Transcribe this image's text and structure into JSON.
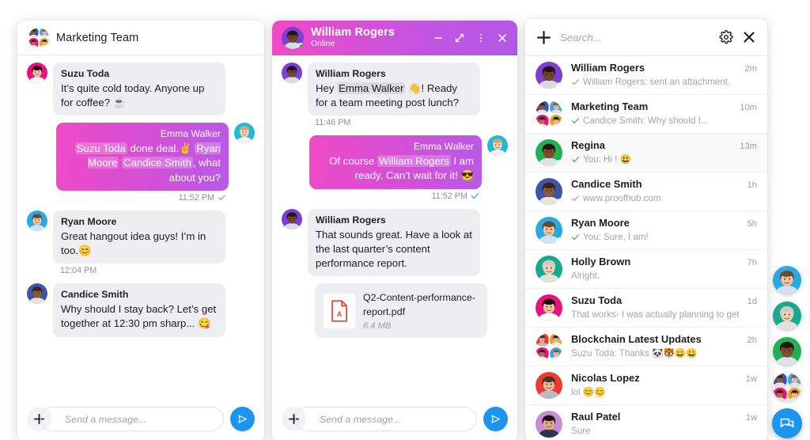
{
  "colors": {
    "accent_blue": "#1b95ef",
    "gradient_from": "#ee4ac6",
    "gradient_to": "#b95ae6",
    "online_green": "#2ed83a",
    "tick_green": "#2fb344",
    "pdf_red": "#e8402a",
    "bubble_in": "#eeedf2"
  },
  "group_panel": {
    "title": "Marketing Team",
    "messages": [
      {
        "direction": "in",
        "sender": "Suzu Toda",
        "parts": [
          {
            "t": "It’s quite cold today. Anyone up for coffee? ☕"
          }
        ],
        "avatar": "suzu"
      },
      {
        "direction": "out",
        "sender": "Emma Walker",
        "parts": [
          {
            "t": "Suzu Toda",
            "mention": true
          },
          {
            "t": " done deal.✌️ "
          },
          {
            "t": "Ryan Moore",
            "mention": true
          },
          {
            "t": " "
          },
          {
            "t": "Candice Smith",
            "mention": true
          },
          {
            "t": ", what about you?"
          }
        ],
        "avatar": "emma",
        "time": "11:52 PM",
        "tick": "gray"
      },
      {
        "direction": "in",
        "sender": "Ryan Moore",
        "parts": [
          {
            "t": "Great hangout idea guys! I’m in too.😊"
          }
        ],
        "avatar": "ryan",
        "time": "12:04 PM"
      },
      {
        "direction": "in",
        "sender": "Candice Smith",
        "parts": [
          {
            "t": "Why should I stay back? Let’s get together at 12:30 pm sharp... 😋"
          }
        ],
        "avatar": "candice"
      }
    ],
    "composer": {
      "placeholder": "Send a message...",
      "value": ""
    }
  },
  "dm_panel": {
    "title": "William Rogers",
    "status": "Online",
    "window_controls": [
      "minimize-icon",
      "expand-icon",
      "more-options-icon",
      "close-icon"
    ],
    "messages": [
      {
        "direction": "in",
        "sender": "William Rogers",
        "parts": [
          {
            "t": "Hey "
          },
          {
            "t": "Emma Walker",
            "mention": true
          },
          {
            "t": " 👋! Ready for a team meeting post lunch?"
          }
        ],
        "avatar": "william",
        "time": "11:46 PM"
      },
      {
        "direction": "out",
        "sender": "Emma Walker",
        "parts": [
          {
            "t": "Of course "
          },
          {
            "t": "William Rogers",
            "mention": true
          },
          {
            "t": " I am ready. Can’t wait for it! 😎"
          }
        ],
        "avatar": "emma",
        "time": "11:52 PM",
        "tick": "blue"
      },
      {
        "direction": "in",
        "sender": "William Rogers",
        "parts": [
          {
            "t": "That sounds great. Have a look at the last quarter’s content performance report."
          }
        ],
        "avatar": "william"
      }
    ],
    "attachment": {
      "filename": "Q2-Content-performance-report.pdf",
      "filesize": "6.4 MB",
      "icon": "pdf-file-icon"
    },
    "composer": {
      "placeholder": "Send a message...",
      "value": ""
    }
  },
  "list_panel": {
    "search": {
      "placeholder": "Search...",
      "value": ""
    },
    "new_chat_label": "+",
    "conversations": [
      {
        "name": "William Rogers",
        "preview": "William Rogers: sent an attachment.",
        "time": "2m",
        "tick": "gray",
        "avatar": "william",
        "online": true,
        "group": false,
        "active": false
      },
      {
        "name": "Marketing Team",
        "preview": "Candice Smith: Why should I...",
        "time": "10m",
        "tick": "green",
        "avatar": "group-marketing",
        "online": false,
        "group": true,
        "active": false
      },
      {
        "name": "Regina",
        "preview": "You: Hi ! 😃",
        "time": "13m",
        "tick": "green",
        "avatar": "regina",
        "online": true,
        "group": false,
        "active": true
      },
      {
        "name": "Candice Smith",
        "preview": "www.proofhub.com",
        "time": "1h",
        "tick": "gray",
        "avatar": "candice",
        "online": true,
        "group": false,
        "active": false
      },
      {
        "name": "Ryan Moore",
        "preview": "You: Sure, I am!",
        "time": "5h",
        "tick": "green",
        "avatar": "ryan",
        "online": true,
        "group": false,
        "active": false
      },
      {
        "name": "Holly Brown",
        "preview": "Alright.",
        "time": "7h",
        "tick": "none",
        "avatar": "holly",
        "online": false,
        "group": false,
        "active": false
      },
      {
        "name": "Suzu Toda",
        "preview": "That works- I was actually planning to get...",
        "time": "1d",
        "tick": "none",
        "avatar": "suzu",
        "online": false,
        "group": false,
        "active": false
      },
      {
        "name": "Blockchain Latest Updates",
        "preview": "Suzu Toda: Thanks  🐼🐯😀😀",
        "time": "2h",
        "tick": "none",
        "avatar": "group-blockchain",
        "online": false,
        "group": true,
        "active": false
      },
      {
        "name": "Nicolas Lopez",
        "preview": "lol 😊😊",
        "time": "1w",
        "tick": "none",
        "avatar": "nicolas",
        "online": false,
        "group": false,
        "active": false
      },
      {
        "name": "Raul Patel",
        "preview": "Sure",
        "time": "1w",
        "tick": "none",
        "avatar": "raul",
        "online": false,
        "group": false,
        "active": false
      }
    ]
  },
  "rail": {
    "items": [
      "ryan",
      "holly",
      "regina",
      "group-marketing"
    ],
    "fab_icon": "chat-bubble-icon"
  }
}
